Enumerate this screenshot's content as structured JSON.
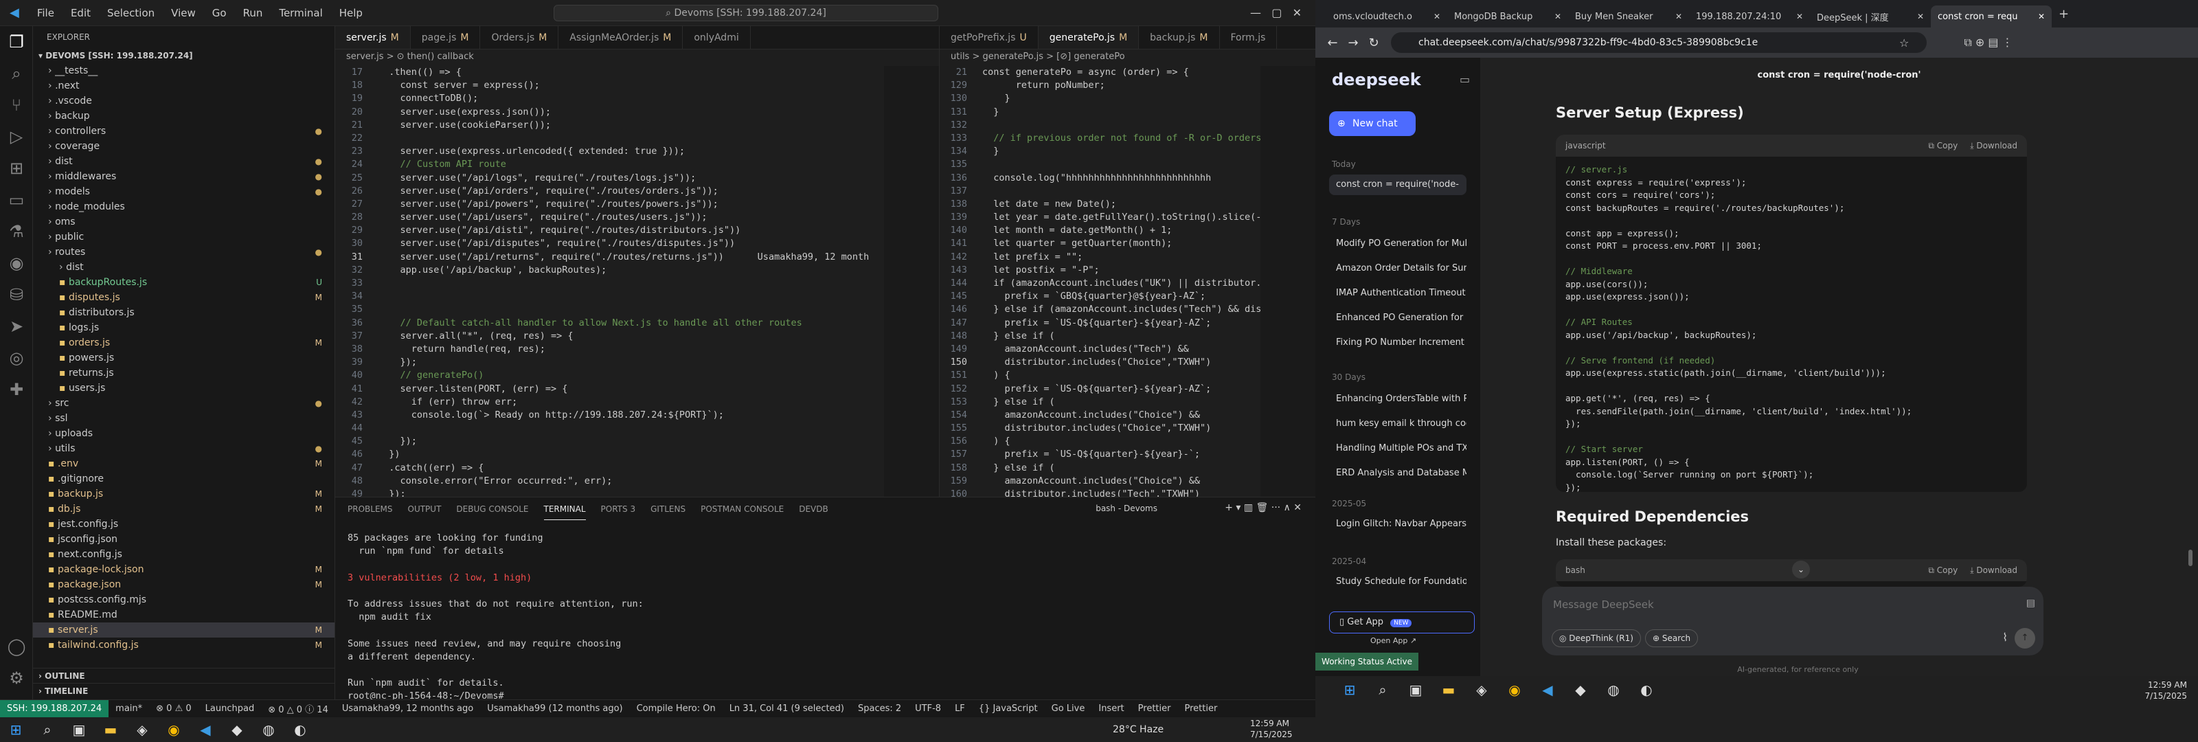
{
  "vscode": {
    "menu": [
      "File",
      "Edit",
      "Selection",
      "View",
      "Go",
      "Run",
      "Terminal",
      "Help"
    ],
    "command_center": "Devoms [SSH: 199.188.207.24]",
    "explorer_title": "EXPLORER",
    "root": "DEVOMS [SSH: 199.188.207.24]",
    "tree": [
      {
        "n": "__tests__",
        "d": 1,
        "b": ""
      },
      {
        "n": ".next",
        "d": 1,
        "b": ""
      },
      {
        "n": ".vscode",
        "d": 1,
        "b": ""
      },
      {
        "n": "backup",
        "d": 1,
        "b": ""
      },
      {
        "n": "controllers",
        "d": 1,
        "b": "●"
      },
      {
        "n": "coverage",
        "d": 1,
        "b": ""
      },
      {
        "n": "dist",
        "d": 1,
        "b": "●"
      },
      {
        "n": "middlewares",
        "d": 1,
        "b": "●"
      },
      {
        "n": "models",
        "d": 1,
        "b": "●"
      },
      {
        "n": "node_modules",
        "d": 1,
        "b": ""
      },
      {
        "n": "oms",
        "d": 1,
        "b": ""
      },
      {
        "n": "public",
        "d": 1,
        "b": ""
      },
      {
        "n": "routes",
        "d": 1,
        "b": "●"
      },
      {
        "n": "dist",
        "d": 2,
        "b": ""
      },
      {
        "n": "backupRoutes.js",
        "d": 2,
        "b": "U"
      },
      {
        "n": "disputes.js",
        "d": 2,
        "b": "M"
      },
      {
        "n": "distributors.js",
        "d": 2,
        "b": ""
      },
      {
        "n": "logs.js",
        "d": 2,
        "b": ""
      },
      {
        "n": "orders.js",
        "d": 2,
        "b": "M"
      },
      {
        "n": "powers.js",
        "d": 2,
        "b": ""
      },
      {
        "n": "returns.js",
        "d": 2,
        "b": ""
      },
      {
        "n": "users.js",
        "d": 2,
        "b": ""
      },
      {
        "n": "src",
        "d": 1,
        "b": "●"
      },
      {
        "n": "ssl",
        "d": 1,
        "b": ""
      },
      {
        "n": "uploads",
        "d": 1,
        "b": ""
      },
      {
        "n": "utils",
        "d": 1,
        "b": "●"
      },
      {
        "n": ".env",
        "d": 1,
        "b": "M"
      },
      {
        "n": ".gitignore",
        "d": 1,
        "b": ""
      },
      {
        "n": "backup.js",
        "d": 1,
        "b": "M"
      },
      {
        "n": "db.js",
        "d": 1,
        "b": "M"
      },
      {
        "n": "jest.config.js",
        "d": 1,
        "b": ""
      },
      {
        "n": "jsconfig.json",
        "d": 1,
        "b": ""
      },
      {
        "n": "next.config.js",
        "d": 1,
        "b": ""
      },
      {
        "n": "package-lock.json",
        "d": 1,
        "b": "M"
      },
      {
        "n": "package.json",
        "d": 1,
        "b": "M"
      },
      {
        "n": "postcss.config.mjs",
        "d": 1,
        "b": ""
      },
      {
        "n": "README.md",
        "d": 1,
        "b": ""
      },
      {
        "n": "server.js",
        "d": 1,
        "b": "M"
      },
      {
        "n": "tailwind.config.js",
        "d": 1,
        "b": "M"
      }
    ],
    "outline": "OUTLINE",
    "timeline": "TIMELINE",
    "left_tabs": [
      "server.js M",
      "page.js M",
      "Orders.js M",
      "AssignMeAOrder.js M",
      "onlyAdmi"
    ],
    "left_bc": "server.js > ⊙ then() callback",
    "left_code": [
      [
        "17",
        "  .then(() => {"
      ],
      [
        "18",
        "    const server = express();"
      ],
      [
        "19",
        "    connectToDB();"
      ],
      [
        "20",
        "    server.use(express.json());"
      ],
      [
        "21",
        "    server.use(cookieParser());"
      ],
      [
        "22",
        ""
      ],
      [
        "23",
        "    server.use(express.urlencoded({ extended: true }));"
      ],
      [
        "24",
        "    // Custom API route"
      ],
      [
        "25",
        "    server.use(\"/api/logs\", require(\"./routes/logs.js\"));"
      ],
      [
        "26",
        "    server.use(\"/api/orders\", require(\"./routes/orders.js\"));"
      ],
      [
        "27",
        "    server.use(\"/api/powers\", require(\"./routes/powers.js\"));"
      ],
      [
        "28",
        "    server.use(\"/api/users\", require(\"./routes/users.js\"));"
      ],
      [
        "29",
        "    server.use(\"/api/disti\", require(\"./routes/distributors.js\"))"
      ],
      [
        "30",
        "    server.use(\"/api/disputes\", require(\"./routes/disputes.js\"))"
      ],
      [
        "31",
        "    server.use(\"/api/returns\", require(\"./routes/returns.js\"))      Usamakha99, 12 month"
      ],
      [
        "32",
        "    app.use('/api/backup', backupRoutes);"
      ],
      [
        "33",
        ""
      ],
      [
        "34",
        ""
      ],
      [
        "35",
        ""
      ],
      [
        "36",
        "    // Default catch-all handler to allow Next.js to handle all other routes"
      ],
      [
        "37",
        "    server.all(\"*\", (req, res) => {"
      ],
      [
        "38",
        "      return handle(req, res);"
      ],
      [
        "39",
        "    });"
      ],
      [
        "40",
        "    // generatePo()"
      ],
      [
        "41",
        "    server.listen(PORT, (err) => {"
      ],
      [
        "42",
        "      if (err) throw err;"
      ],
      [
        "43",
        "      console.log(`> Ready on http://199.188.207.24:${PORT}`);"
      ],
      [
        "44",
        ""
      ],
      [
        "45",
        "    });"
      ],
      [
        "46",
        "  })"
      ],
      [
        "47",
        "  .catch((err) => {"
      ],
      [
        "48",
        "    console.error(\"Error occurred:\", err);"
      ],
      [
        "49",
        "  });"
      ]
    ],
    "right_tabs": [
      "getPoPrefix.js U",
      "generatePo.js M",
      "backup.js M",
      "Form.js"
    ],
    "right_bc": "utils > generatePo.js > [⊘] generatePo",
    "right_code": [
      [
        "21",
        "const generatePo = async (order) => {"
      ],
      [
        "129",
        "      return poNumber;"
      ],
      [
        "130",
        "    }"
      ],
      [
        "131",
        "  }"
      ],
      [
        "132",
        ""
      ],
      [
        "133",
        "  // if previous order not found of -R or-D orders"
      ],
      [
        "134",
        "  }"
      ],
      [
        "135",
        ""
      ],
      [
        "136",
        "  console.log(\"hhhhhhhhhhhhhhhhhhhhhhhhhh"
      ],
      [
        "137",
        ""
      ],
      [
        "138",
        "  let date = new Date();"
      ],
      [
        "139",
        "  let year = date.getFullYear().toString().slice(-2);"
      ],
      [
        "140",
        "  let month = date.getMonth() + 1;"
      ],
      [
        "141",
        "  let quarter = getQuarter(month);"
      ],
      [
        "142",
        "  let prefix = \"\";"
      ],
      [
        "143",
        "  let postfix = \"-P\";"
      ],
      [
        "144",
        "  if (amazonAccount.includes(\"UK\") || distributor.incl"
      ],
      [
        "145",
        "    prefix = `GBQ${quarter}@${year}-AZ`;"
      ],
      [
        "146",
        "  } else if (amazonAccount.includes(\"Tech\") && distrib"
      ],
      [
        "147",
        "    prefix = `US-Q${quarter}-${year}-AZ`;"
      ],
      [
        "148",
        "  } else if ("
      ],
      [
        "149",
        "    amazonAccount.includes(\"Tech\") &&"
      ],
      [
        "150",
        "    distributor.includes(\"Choice\",\"TXWH\")"
      ],
      [
        "151",
        "  ) {"
      ],
      [
        "152",
        "    prefix = `US-Q${quarter}-${year}-AZ`;"
      ],
      [
        "153",
        "  } else if ("
      ],
      [
        "154",
        "    amazonAccount.includes(\"Choice\") &&"
      ],
      [
        "155",
        "    distributor.includes(\"Choice\",\"TXWH\")"
      ],
      [
        "156",
        "  ) {"
      ],
      [
        "157",
        "    prefix = `US-Q${quarter}-${year}-`;"
      ],
      [
        "158",
        "  } else if ("
      ],
      [
        "159",
        "    amazonAccount.includes(\"Choice\") &&"
      ],
      [
        "160",
        "    distributor.includes(\"Tech\",\"TXWH\")"
      ]
    ],
    "panel_tabs": [
      "PROBLEMS",
      "OUTPUT",
      "DEBUG CONSOLE",
      "TERMINAL",
      "PORTS 3",
      "GITLENS",
      "POSTMAN CONSOLE",
      "DEVDB"
    ],
    "terminal_title": "bash - Devoms",
    "terminal": [
      "85 packages are looking for funding",
      "  run `npm fund` for details",
      "",
      "3 vulnerabilities (2 low, 1 high)",
      "",
      "To address issues that do not require attention, run:",
      "  npm audit fix",
      "",
      "Some issues need review, and may require choosing",
      "a different dependency.",
      "",
      "Run `npm audit` for details.",
      "root@nc-ph-1564-48:~/Devoms# "
    ],
    "status": [
      "SSH: 199.188.207.24",
      "main*",
      "⊗ 0 ⚠ 0",
      "Launchpad",
      "⊗ 0 △ 0 ⓘ 14",
      "Usamakha99, 12 months ago",
      "Usamakha99 (12 months ago)",
      "Compile Hero: On",
      "Ln 31, Col 41 (9 selected)",
      "Spaces: 2",
      "UTF-8",
      "LF",
      "{} JavaScript",
      "Go Live",
      "Insert",
      "Prettier",
      "Prettier"
    ],
    "weather": "28°C Haze",
    "time": "12:59 AM",
    "date": "7/15/2025"
  },
  "chrome": {
    "tabs": [
      "oms.vcloudtech.o",
      "MongoDB Backup",
      "Buy Men Sneaker",
      "199.188.207.24:10",
      "DeepSeek | 深度",
      "const cron = requ"
    ],
    "url": "chat.deepseek.com/a/chat/s/9987322b-ff9c-4bd0-83c5-389908bc9c1e"
  },
  "deepseek": {
    "logo": "deepseek",
    "new_chat": "New chat",
    "today": "Today",
    "today_item": "const cron = require('node-",
    "d7": "7 Days",
    "d7_items": [
      "Modify PO Generation for Multip",
      "Amazon Order Details for Surge",
      "IMAP Authentication Timeout Er",
      "Enhanced PO Generation for Mu",
      "Fixing PO Number Increment Iss"
    ],
    "d30": "30 Days",
    "d30_items": [
      "Enhancing OrdersTable with Pro",
      "hum kesy email k through code",
      "Handling Multiple POs and TXW",
      "ERD Analysis and Database Mod"
    ],
    "m2505": "2025-05",
    "m2505_item": "Login Glitch: Navbar Appears Al",
    "m2504": "2025-04",
    "m2504_item": "Study Schedule for Foundation S",
    "get_app": "Get App",
    "get_app_badge": "NEW",
    "open_app": "Open App ↗",
    "chat_title": "const cron = require('node-cron'",
    "h_server": "Server Setup (Express)",
    "lang1": "javascript",
    "copy": "Copy",
    "download": "Download",
    "code1": [
      [
        "cmt",
        "// server.js"
      ],
      [
        "",
        "const express = require('express');"
      ],
      [
        "",
        "const cors = require('cors');"
      ],
      [
        "",
        "const backupRoutes = require('./routes/backupRoutes');"
      ],
      [
        "",
        ""
      ],
      [
        "",
        "const app = express();"
      ],
      [
        "",
        "const PORT = process.env.PORT || 3001;"
      ],
      [
        "",
        ""
      ],
      [
        "cmt",
        "// Middleware"
      ],
      [
        "",
        "app.use(cors());"
      ],
      [
        "",
        "app.use(express.json());"
      ],
      [
        "",
        ""
      ],
      [
        "cmt",
        "// API Routes"
      ],
      [
        "",
        "app.use('/api/backup', backupRoutes);"
      ],
      [
        "",
        ""
      ],
      [
        "cmt",
        "// Serve frontend (if needed)"
      ],
      [
        "",
        "app.use(express.static(path.join(__dirname, 'client/build')));"
      ],
      [
        "",
        ""
      ],
      [
        "",
        "app.get('*', (req, res) => {"
      ],
      [
        "",
        "  res.sendFile(path.join(__dirname, 'client/build', 'index.html'));"
      ],
      [
        "",
        "});"
      ],
      [
        "",
        ""
      ],
      [
        "cmt",
        "// Start server"
      ],
      [
        "",
        "app.listen(PORT, () => {"
      ],
      [
        "",
        "  console.log(`Server running on port ${PORT}`);"
      ],
      [
        "",
        "});"
      ]
    ],
    "h_deps": "Required Dependencies",
    "install": "Install these packages:",
    "lang2": "bash",
    "placeholder": "Message DeepSeek",
    "deepthink": "DeepThink (R1)",
    "search": "Search",
    "footer": "AI-generated, for reference only"
  },
  "taskbar_right": {
    "toast": "Working Status Active",
    "time": "12:59 AM",
    "date": "7/15/2025"
  }
}
